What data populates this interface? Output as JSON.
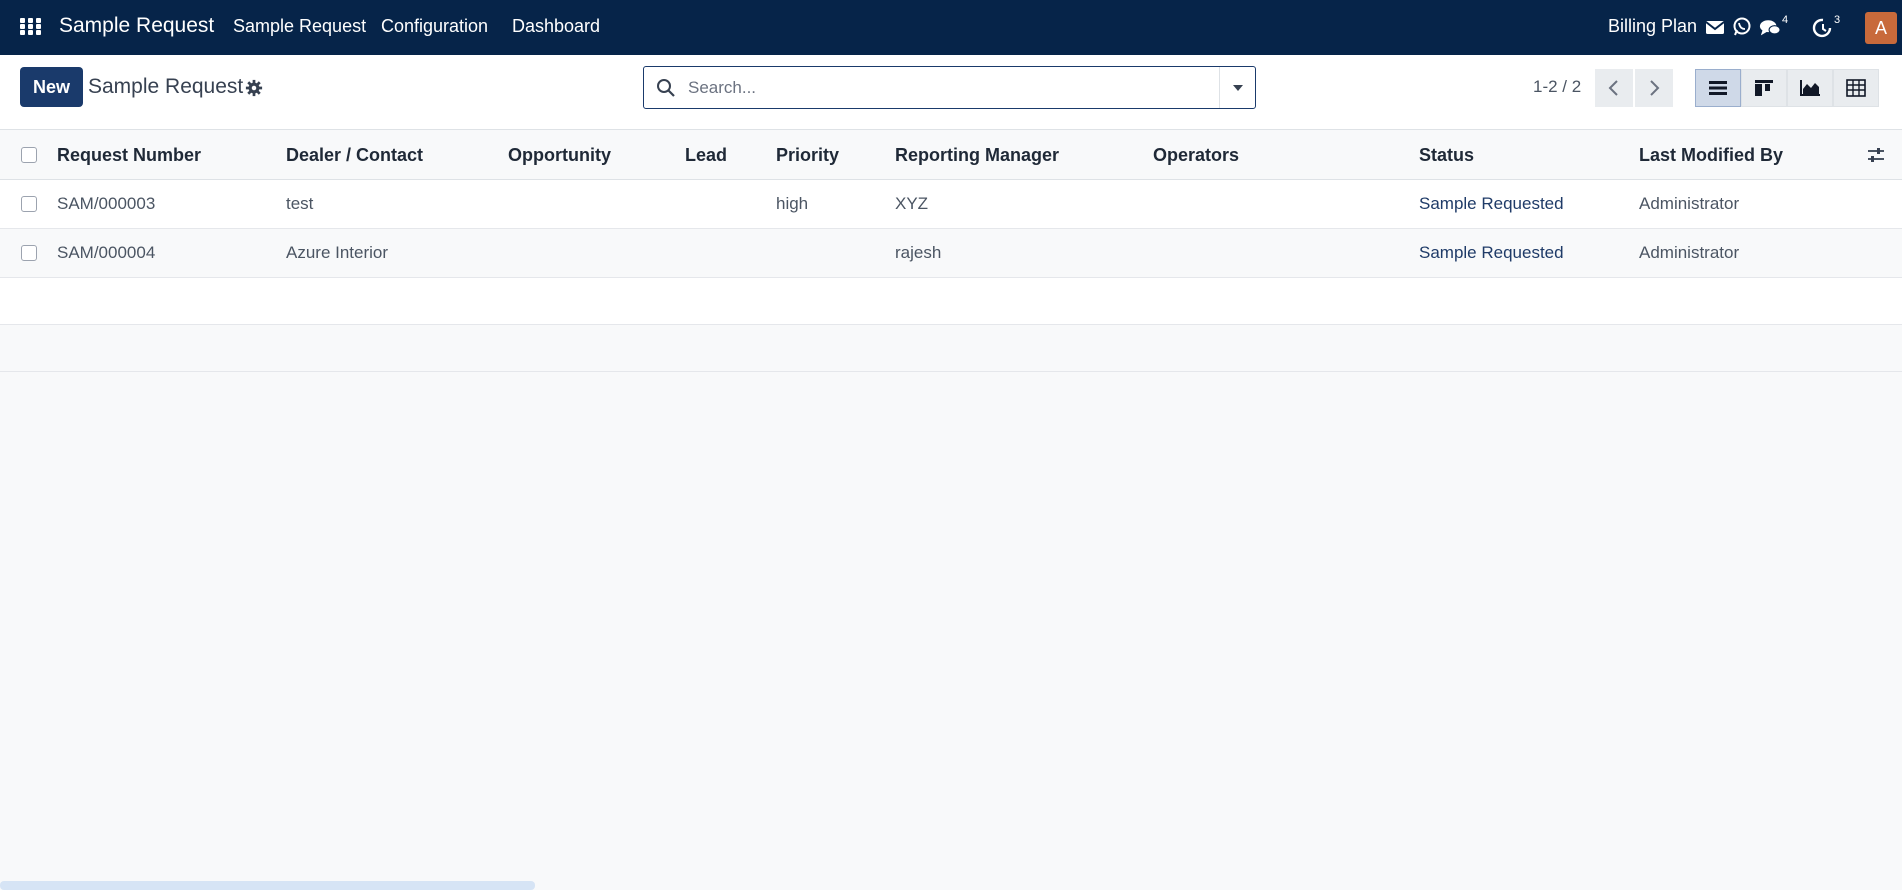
{
  "navbar": {
    "brand": "Sample Request",
    "menus": [
      "Sample Request",
      "Configuration",
      "Dashboard"
    ],
    "billing_plan": "Billing Plan",
    "messages_count": "4",
    "activities_count": "3",
    "avatar_letter": "A",
    "background": "#062449"
  },
  "control_panel": {
    "new_label": "New",
    "title": "Sample Request",
    "search_placeholder": "Search...",
    "pager": "1-2 / 2",
    "views": [
      "list",
      "kanban",
      "graph",
      "pivot"
    ],
    "active_view": "list"
  },
  "table": {
    "columns": [
      "Request Number",
      "Dealer / Contact",
      "Opportunity",
      "Lead",
      "Priority",
      "Reporting Manager",
      "Operators",
      "Status",
      "Last Modified By"
    ],
    "rows": [
      {
        "request_number": "SAM/000003",
        "dealer": "test",
        "opportunity": "",
        "lead": "",
        "priority": "high",
        "manager": "XYZ",
        "operators": "",
        "status": "Sample Requested",
        "modified_by": "Administrator"
      },
      {
        "request_number": "SAM/000004",
        "dealer": "Azure Interior",
        "opportunity": "",
        "lead": "",
        "priority": "",
        "manager": "rajesh",
        "operators": "",
        "status": "Sample Requested",
        "modified_by": "Administrator"
      }
    ]
  }
}
